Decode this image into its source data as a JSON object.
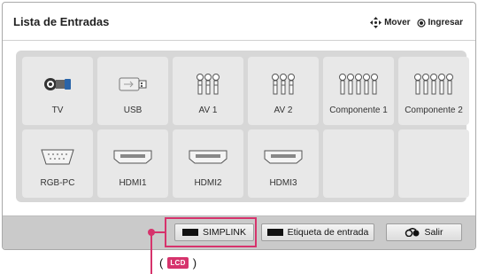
{
  "header": {
    "title": "Lista de Entradas",
    "hints": [
      {
        "icon": "move-arrows-icon",
        "label": "Mover"
      },
      {
        "icon": "ok-button-icon",
        "label": "Ingresar"
      }
    ]
  },
  "inputs": [
    {
      "label": "TV",
      "icon": "tv-antenna-icon"
    },
    {
      "label": "USB",
      "icon": "usb-icon"
    },
    {
      "label": "AV 1",
      "icon": "rca-connectors-icon"
    },
    {
      "label": "AV 2",
      "icon": "rca-connectors-icon"
    },
    {
      "label": "Componente 1",
      "icon": "component-connectors-icon"
    },
    {
      "label": "Componente 2",
      "icon": "component-connectors-icon"
    },
    {
      "label": "RGB-PC",
      "icon": "vga-port-icon"
    },
    {
      "label": "HDMI1",
      "icon": "hdmi-port-icon"
    },
    {
      "label": "HDMI2",
      "icon": "hdmi-port-icon"
    },
    {
      "label": "HDMI3",
      "icon": "hdmi-port-icon"
    },
    {
      "label": "",
      "icon": ""
    },
    {
      "label": "",
      "icon": ""
    }
  ],
  "footer": {
    "simplink_label": "SIMPLINK",
    "input_label_label": "Etiqueta de entrada",
    "exit_label": "Salir"
  },
  "annotation": {
    "open_paren": "(",
    "badge": "LCD",
    "close_paren": ")",
    "color": "#d6336c"
  }
}
